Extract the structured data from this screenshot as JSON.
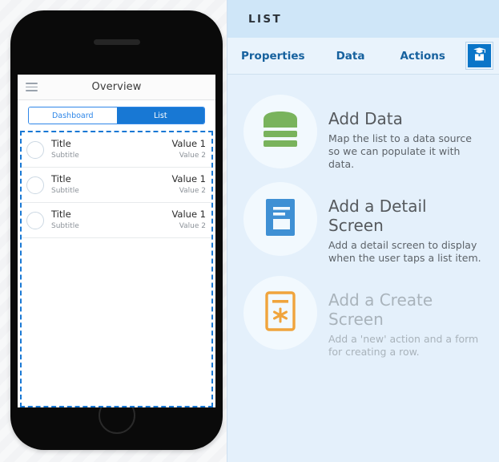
{
  "device": {
    "nav": {
      "menu_icon": "hamburger-menu-icon",
      "title": "Overview"
    },
    "segmented": {
      "options": [
        {
          "label": "Dashboard",
          "selected": false
        },
        {
          "label": "List",
          "selected": true
        }
      ]
    },
    "list": {
      "selected": true,
      "rows": [
        {
          "title": "Title",
          "subtitle": "Subtitle",
          "value1": "Value 1",
          "value2": "Value 2"
        },
        {
          "title": "Title",
          "subtitle": "Subtitle",
          "value1": "Value 1",
          "value2": "Value 2"
        },
        {
          "title": "Title",
          "subtitle": "Subtitle",
          "value1": "Value 1",
          "value2": "Value 2"
        }
      ]
    }
  },
  "panel": {
    "header_title": "LIST",
    "tabs": [
      {
        "label": "Properties",
        "selected": false
      },
      {
        "label": "Data",
        "selected": false
      },
      {
        "label": "Actions",
        "selected": false
      }
    ],
    "tab_action_icon": "graduation-cap-icon",
    "cards": [
      {
        "icon": "database-icon",
        "title": "Add Data",
        "description": "Map the list to a data source so we can populate it with data.",
        "disabled": false
      },
      {
        "icon": "detail-screen-icon",
        "title": "Add a Detail Screen",
        "description": "Add a detail screen to display when the user taps a list item.",
        "disabled": false
      },
      {
        "icon": "create-screen-icon",
        "title": "Add a Create Screen",
        "description": "Add a 'new' action and a form for creating a row.",
        "disabled": true
      }
    ]
  },
  "colors": {
    "accent_blue": "#1878d4",
    "panel_bg": "#e4f0fb",
    "panel_header_bg": "#cfe6f8",
    "tab_text": "#16619e",
    "green_icon": "#79b35c",
    "blue_icon": "#3f90d4",
    "orange_icon": "#f0a43c"
  }
}
